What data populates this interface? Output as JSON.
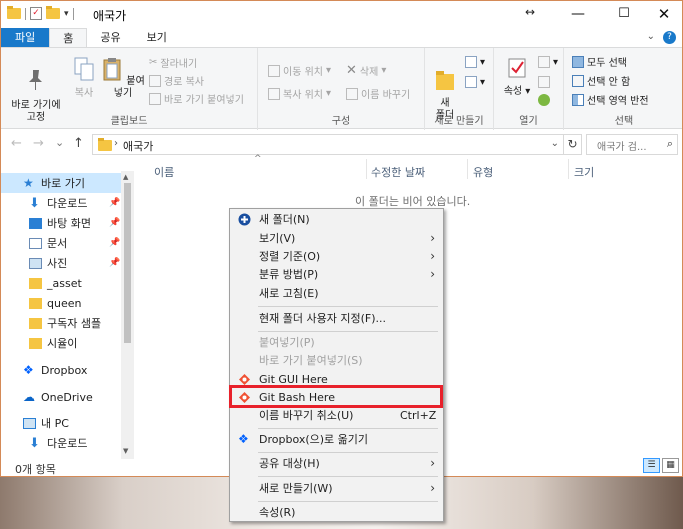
{
  "window": {
    "title": "애국가",
    "resize_glyph": "↔",
    "min": "—",
    "max": "☐",
    "close": "✕"
  },
  "ribbon_tabs": [
    "파일",
    "홈",
    "공유",
    "보기"
  ],
  "ribbon": {
    "clipboard": {
      "pin": "바로 가기에\n고정",
      "copy": "복사",
      "paste": "붙여넣기",
      "cut": "잘라내기",
      "copy_path": "경로 복사",
      "paste_shortcut": "바로 가기 붙여넣기",
      "label": "클립보드"
    },
    "organize": {
      "move_to": "이동 위치",
      "copy_to": "복사 위치",
      "delete": "삭제",
      "rename": "이름 바꾸기",
      "label": "구성"
    },
    "new": {
      "new_folder": "새\n폴더",
      "label": "새로 만들기"
    },
    "open": {
      "properties": "속성",
      "label": "열기"
    },
    "select": {
      "select_all": "모두 선택",
      "select_none": "선택 안 함",
      "invert": "선택 영역 반전",
      "label": "선택"
    }
  },
  "address": {
    "back": "←",
    "forward": "→",
    "recent": "⌄",
    "up": "↑",
    "path": "애국가",
    "refresh": "↻",
    "search_placeholder": "애국가 검..."
  },
  "nav_pane": {
    "items": [
      {
        "label": "바로 가기",
        "icon": "star-icon"
      },
      {
        "label": "다운로드",
        "icon": "download-icon",
        "pinned": true
      },
      {
        "label": "바탕 화면",
        "icon": "desktop-icon",
        "pinned": true
      },
      {
        "label": "문서",
        "icon": "document-icon",
        "pinned": true
      },
      {
        "label": "사진",
        "icon": "picture-icon",
        "pinned": true
      },
      {
        "label": "_asset",
        "icon": "folder-icon"
      },
      {
        "label": "queen",
        "icon": "folder-icon"
      },
      {
        "label": "구독자 샘플",
        "icon": "folder-icon"
      },
      {
        "label": "시율이",
        "icon": "folder-icon"
      },
      {
        "label": "Dropbox",
        "icon": "dropbox-icon"
      },
      {
        "label": "OneDrive",
        "icon": "onedrive-icon"
      },
      {
        "label": "내 PC",
        "icon": "pc-icon"
      },
      {
        "label": "다운로드",
        "icon": "download-icon"
      }
    ]
  },
  "columns": [
    "이름",
    "수정한 날짜",
    "유형",
    "크기"
  ],
  "empty_message": "이 폴더는 비어 있습니다.",
  "status_text": "0개 항목",
  "context_menu": {
    "items": [
      {
        "label": "새 폴더(N)",
        "icon": "new-folder-icon"
      },
      {
        "label": "보기(V)",
        "submenu": true
      },
      {
        "label": "정렬 기준(O)",
        "submenu": true
      },
      {
        "label": "분류 방법(P)",
        "submenu": true
      },
      {
        "label": "새로 고침(E)"
      },
      {
        "label": "현재 폴더 사용자 지정(F)..."
      },
      {
        "label": "붙여넣기(P)",
        "disabled": true
      },
      {
        "label": "바로 가기 붙여넣기(S)",
        "disabled": true
      },
      {
        "label": "Git GUI Here",
        "icon": "git-icon"
      },
      {
        "label": "Git Bash Here",
        "icon": "git-icon",
        "highlighted": true
      },
      {
        "label": "이름 바꾸기 취소(U)",
        "shortcut": "Ctrl+Z"
      },
      {
        "label": "Dropbox(으)로 옮기기",
        "icon": "dropbox-icon"
      },
      {
        "label": "공유 대상(H)",
        "submenu": true
      },
      {
        "label": "새로 만들기(W)",
        "submenu": true
      },
      {
        "label": "속성(R)"
      }
    ],
    "submenu_glyph": "›"
  },
  "colors": {
    "file_tab": "#1979ca",
    "selection": "#cce8ff",
    "highlight_box": "#e8212b"
  }
}
